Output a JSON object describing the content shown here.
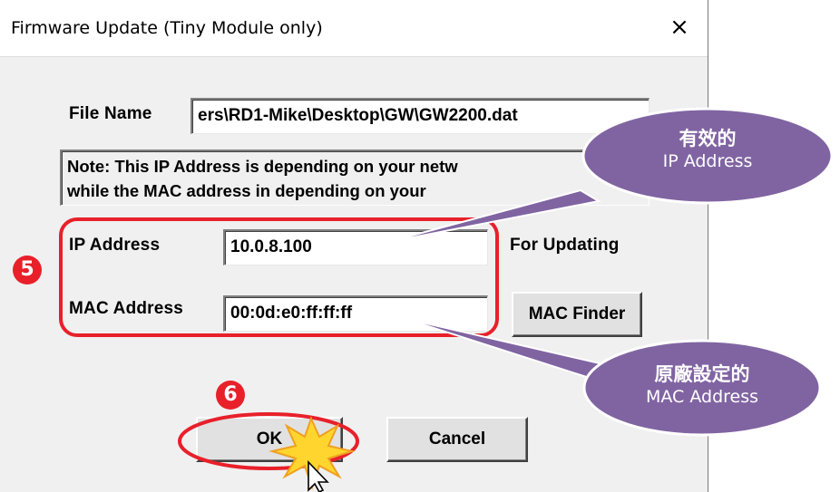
{
  "window": {
    "title": "Firmware Update (Tiny Module only)",
    "close_glyph": "×"
  },
  "form": {
    "file_name_label": "File Name",
    "file_name_value": "ers\\RD1-Mike\\Desktop\\GW\\GW2200.dat",
    "note_line1": "Note: This IP Address is depending on your netw",
    "note_line2": "while the  MAC address in depending on your",
    "ip_label": "IP Address",
    "ip_value": "10.0.8.100",
    "for_updating": "For Updating",
    "mac_label": "MAC Address",
    "mac_value": "00:0d:e0:ff:ff:ff",
    "mac_finder_label": "MAC Finder",
    "ok_label": "OK",
    "cancel_label": "Cancel"
  },
  "annotations": {
    "step5": "5",
    "step6": "6",
    "callout_ip_zh": "有效的",
    "callout_ip_en": "IP Address",
    "callout_mac_zh": "原廠設定的",
    "callout_mac_en": "MAC Address"
  },
  "colors": {
    "highlight_red": "#e8202a",
    "callout_purple": "#8064a2",
    "starburst_yellow": "#ffd52e"
  },
  "icons": [
    "close-icon",
    "mouse-cursor-icon",
    "click-starburst-icon"
  ]
}
